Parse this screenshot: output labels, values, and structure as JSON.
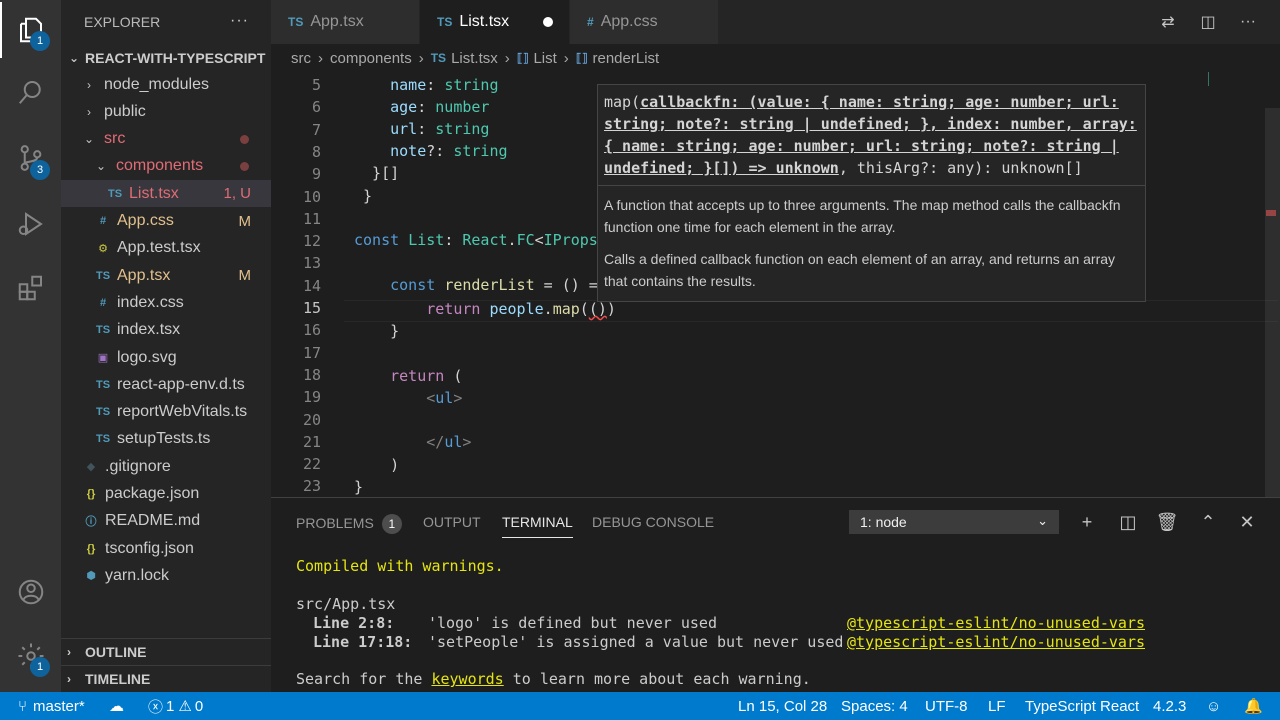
{
  "activity_bar": {
    "explorer_badge": "1",
    "source_control_badge": "3",
    "settings_badge": "1"
  },
  "sidebar": {
    "title": "EXPLORER",
    "more": "···",
    "project": "REACT-WITH-TYPESCRIPT",
    "items": [
      {
        "label": "node_modules",
        "type": "folder",
        "deco": ""
      },
      {
        "label": "public",
        "type": "folder",
        "deco": ""
      },
      {
        "label": "src",
        "type": "folder-open",
        "deco": "dot"
      },
      {
        "label": "components",
        "type": "folder-open",
        "deco": "dot"
      },
      {
        "label": "List.tsx",
        "type": "ts",
        "deco": "1, U"
      },
      {
        "label": "App.css",
        "type": "css",
        "deco": "M"
      },
      {
        "label": "App.test.tsx",
        "type": "test",
        "deco": ""
      },
      {
        "label": "App.tsx",
        "type": "ts",
        "deco": "M"
      },
      {
        "label": "index.css",
        "type": "css",
        "deco": ""
      },
      {
        "label": "index.tsx",
        "type": "ts",
        "deco": ""
      },
      {
        "label": "logo.svg",
        "type": "svg",
        "deco": ""
      },
      {
        "label": "react-app-env.d.ts",
        "type": "ts",
        "deco": ""
      },
      {
        "label": "reportWebVitals.ts",
        "type": "ts",
        "deco": ""
      },
      {
        "label": "setupTests.ts",
        "type": "ts",
        "deco": ""
      },
      {
        "label": ".gitignore",
        "type": "git",
        "deco": ""
      },
      {
        "label": "package.json",
        "type": "json",
        "deco": ""
      },
      {
        "label": "README.md",
        "type": "md",
        "deco": ""
      },
      {
        "label": "tsconfig.json",
        "type": "json",
        "deco": ""
      },
      {
        "label": "yarn.lock",
        "type": "yarn",
        "deco": ""
      }
    ],
    "outline": "OUTLINE",
    "timeline": "TIMELINE"
  },
  "tabs": [
    {
      "icon": "TS",
      "label": "App.tsx"
    },
    {
      "icon": "TS",
      "label": "List.tsx"
    },
    {
      "icon": "#",
      "label": "App.css"
    }
  ],
  "breadcrumb": {
    "src": "src",
    "components": "components",
    "file_icon": "TS",
    "file": "List.tsx",
    "symbol1": "List",
    "symbol2": "renderList"
  },
  "editor": {
    "line_numbers": [
      "5",
      "6",
      "7",
      "8",
      "9",
      "10",
      "11",
      "12",
      "13",
      "14",
      "15",
      "16",
      "17",
      "18",
      "19",
      "20",
      "21",
      "22",
      "23"
    ]
  },
  "hover": {
    "sig_prefix": "map(",
    "sig_highlight": "callbackfn: (value: { name: string; age: number; url: string; note?: string | undefined; }, index: number, array: { name: string; age: number; url: string; note?: string | undefined; }[]) => unknown",
    "sig_suffix": ", thisArg?: any): unknown[]",
    "doc1": "A function that accepts up to three arguments. The map method calls the callbackfn function one time for each element in the array.",
    "doc2": "Calls a defined callback function on each element of an array, and returns an array that contains the results."
  },
  "panel": {
    "tabs": {
      "problems": "PROBLEMS",
      "problems_count": "1",
      "output": "OUTPUT",
      "terminal": "TERMINAL",
      "debug": "DEBUG CONSOLE"
    },
    "terminal_select": "1: node",
    "lines": {
      "compiled": "Compiled with warnings.",
      "file": "src/App.tsx",
      "w1_loc": "Line 2:8:",
      "w1_msg": "'logo' is defined but never used",
      "w1_rule": "@typescript-eslint/no-unused-vars",
      "w2_loc": "Line 17:18:",
      "w2_msg": "'setPeople' is assigned a value but never used",
      "w2_rule": "@typescript-eslint/no-unused-vars",
      "search_pre": "Search for the ",
      "search_kw": "keywords",
      "search_post": " to learn more about each warning."
    }
  },
  "status": {
    "branch": "master*",
    "errors": "1",
    "warnings": "0",
    "position": "Ln 15, Col 28",
    "spaces": "Spaces: 4",
    "encoding": "UTF-8",
    "eol": "LF",
    "language": "TypeScript React",
    "version": "4.2.3"
  },
  "colors": {
    "accent": "#007acc",
    "ts": "#519aba",
    "css": "#519aba",
    "modified": "#e2c08d",
    "error": "#f14c4c"
  }
}
